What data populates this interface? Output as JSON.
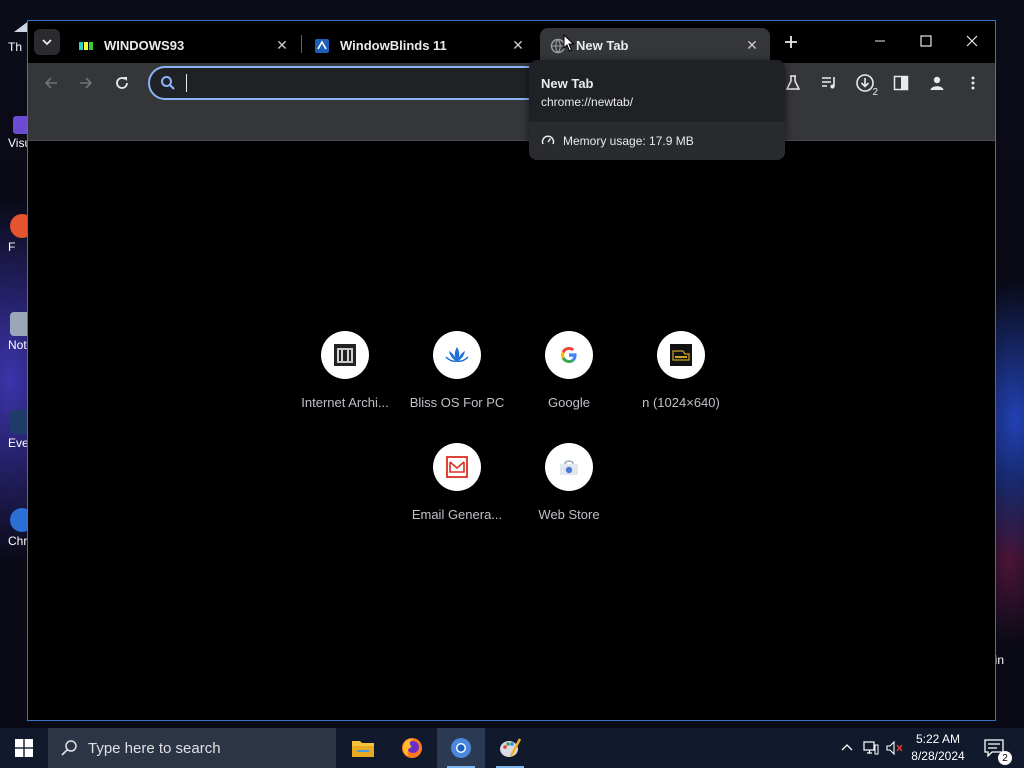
{
  "desktop": {
    "icons": [
      {
        "label": "Th"
      },
      {
        "label": "Visu"
      },
      {
        "label": "F"
      },
      {
        "label": "Not"
      },
      {
        "label": "Eve"
      },
      {
        "label": "Chr"
      }
    ],
    "right_text": "in"
  },
  "browser": {
    "tabs": [
      {
        "title": "WINDOWS93",
        "favicon": "windows93-icon"
      },
      {
        "title": "WindowBlinds 11",
        "favicon": "windowblinds-icon"
      },
      {
        "title": "New Tab",
        "favicon": "globe-icon",
        "active": true
      }
    ],
    "omnibox": {
      "value": "",
      "placeholder": ""
    },
    "toolbar_icons": [
      "labs-icon",
      "media-control-icon",
      "download-icon",
      "side-panel-icon",
      "profile-icon",
      "menu-icon"
    ],
    "download_count": "2"
  },
  "hovercard": {
    "title": "New Tab",
    "url": "chrome://newtab/",
    "memory": "Memory usage: 17.9 MB"
  },
  "shortcuts": [
    {
      "label": "Internet Archi...",
      "icon": "archive-icon"
    },
    {
      "label": "Bliss OS For PC",
      "icon": "lotus-icon"
    },
    {
      "label": "Google",
      "icon": "google-icon"
    },
    {
      "label": "n (1024×640)",
      "icon": "thumbnail-icon"
    },
    {
      "label": "Email Genera...",
      "icon": "email-icon"
    },
    {
      "label": "Web Store",
      "icon": "webstore-icon"
    }
  ],
  "taskbar": {
    "search_placeholder": "Type here to search",
    "apps": [
      "file-explorer-icon",
      "firefox-icon",
      "chrome-icon",
      "paint-icon"
    ],
    "time": "5:22 AM",
    "date": "8/28/2024",
    "notification_count": "2"
  },
  "colors": {
    "accent": "#8ab4f8",
    "tab_active": "#35363a",
    "taskbar": "#101a2c"
  }
}
